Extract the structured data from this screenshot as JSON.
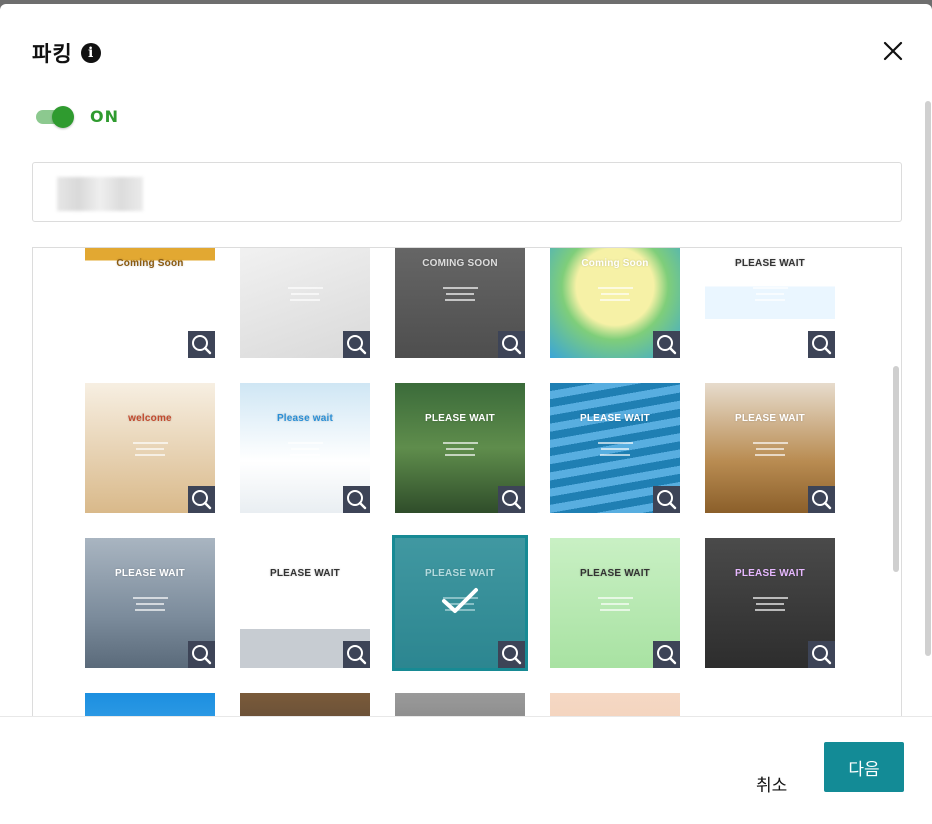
{
  "dialog": {
    "title": "파킹",
    "toggle_label": "ON",
    "toggle_on": true,
    "info_icon": "info-icon",
    "close_icon": "close-icon"
  },
  "colors": {
    "accent": "#138b96",
    "toggle_on": "#2f9b2f",
    "zoom_button": "#3d4457"
  },
  "templates": [
    {
      "text": "Coming Soon",
      "bg": "linear-gradient(180deg,#e2a832 0 25%,#ffffff 25% 100%)",
      "fg": "#8a5a10"
    },
    {
      "text": "",
      "bg": "linear-gradient(160deg,#f4f4f4,#d9d9d9)",
      "fg": "#777"
    },
    {
      "text": "COMING SOON",
      "bg": "linear-gradient(180deg,#6a6a6a,#4e4e4e)",
      "fg": "#ddd"
    },
    {
      "text": "Coming Soon",
      "bg": "radial-gradient(circle at 50% 45%,#f6f1a6 0 40%,#7fce7a 55%,#3aa5d8 100%)",
      "fg": "#fff"
    },
    {
      "text": "PLEASE WAIT",
      "bg": "linear-gradient(180deg,#ffffff 0 45%,#eaf6ff 45% 70%,#ffffff 70%)",
      "fg": "#333"
    },
    {
      "text": "welcome",
      "bg": "linear-gradient(180deg,#f7efe2,#d9b98a)",
      "fg": "#c24a2e"
    },
    {
      "text": "Please wait",
      "bg": "linear-gradient(180deg,#cfe6f4,#ffffff 60%,#e9eef2)",
      "fg": "#2a8fd6"
    },
    {
      "text": "PLEASE WAIT",
      "bg": "linear-gradient(180deg,#3b6b3a,#5f8d4c 50%,#2f4d2a)",
      "fg": "#fff"
    },
    {
      "text": "PLEASE WAIT",
      "bg": "repeating-linear-gradient(170deg,#1f7fb3 0 8px,#58aee0 8px 16px)",
      "fg": "#fff"
    },
    {
      "text": "PLEASE WAIT",
      "bg": "linear-gradient(180deg,#e7dccd,#b98c52 60%,#8b5f2a)",
      "fg": "#fff"
    },
    {
      "text": "PLEASE WAIT",
      "bg": "linear-gradient(180deg,#a9b5c1,#7c8c9c 60%,#5a6a7a)",
      "fg": "#fff"
    },
    {
      "text": "PLEASE WAIT",
      "bg": "linear-gradient(180deg,#ffffff 0 70%,#c7ccd2 70%)",
      "fg": "#333"
    },
    {
      "text": "PLEASE WAIT",
      "bg": "linear-gradient(180deg,#4e9aa2,#2f7e88)",
      "fg": "#fff"
    },
    {
      "text": "PLEASE WAIT",
      "bg": "linear-gradient(180deg,#c9f0c4,#a8e2a2)",
      "fg": "#333"
    },
    {
      "text": "PLEASE WAIT",
      "bg": "linear-gradient(180deg,#4a4a4a,#2d2d2d)",
      "fg": "#e7b8ff"
    },
    {
      "text": "",
      "bg": "linear-gradient(180deg,#1c8fe0,#6ec3f5)",
      "fg": "#fff"
    },
    {
      "text": "",
      "bg": "linear-gradient(180deg,#7a5a3a,#2f2f2f)",
      "fg": "#fff"
    },
    {
      "text": "",
      "bg": "linear-gradient(180deg,#9a9a9a,#5d5d5d)",
      "fg": "#fff"
    },
    {
      "text": "",
      "bg": "linear-gradient(180deg,#f5d8c4,#efc4a8)",
      "fg": "#fff"
    }
  ],
  "selected_index": 12,
  "footer": {
    "cancel_label": "취소",
    "next_label": "다음"
  }
}
